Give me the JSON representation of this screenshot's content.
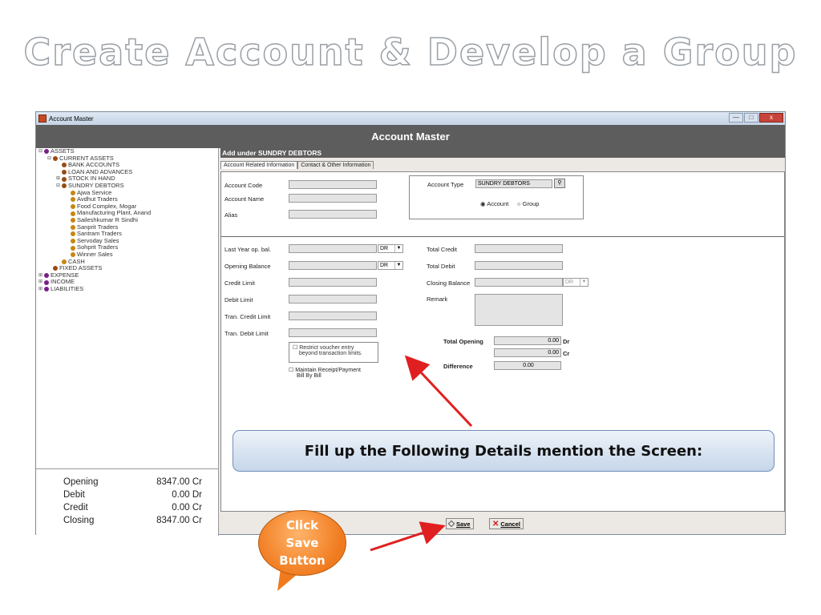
{
  "slide_title": "Create  Account & Develop a Group",
  "window": {
    "title": "Account Master",
    "header": "Account Master",
    "controls": {
      "minimize": "—",
      "maximize": "□",
      "close": "x"
    }
  },
  "tree": [
    {
      "label": "ASSETS",
      "level": 0,
      "expander": "⊟",
      "icon": "purple"
    },
    {
      "label": "CURRENT ASSETS",
      "level": 1,
      "expander": "⊟",
      "icon": "brown"
    },
    {
      "label": "BANK ACCOUNTS",
      "level": 2,
      "expander": "",
      "icon": "brown"
    },
    {
      "label": "LOAN AND ADVANCES",
      "level": 2,
      "expander": "",
      "icon": "brown"
    },
    {
      "label": "STOCK IN HAND",
      "level": 2,
      "expander": "⊞",
      "icon": "brown"
    },
    {
      "label": "SUNDRY DEBTORS",
      "level": 2,
      "expander": "⊟",
      "icon": "brown"
    },
    {
      "label": "Ajwa Service",
      "level": 3,
      "expander": "",
      "icon": "gold"
    },
    {
      "label": "Avdhut Traders",
      "level": 3,
      "expander": "",
      "icon": "gold"
    },
    {
      "label": "Food Complex, Mogar",
      "level": 3,
      "expander": "",
      "icon": "gold"
    },
    {
      "label": "Manufacturing Plant, Anand",
      "level": 3,
      "expander": "",
      "icon": "gold"
    },
    {
      "label": "Saileshkumar R Sindhi",
      "level": 3,
      "expander": "",
      "icon": "gold"
    },
    {
      "label": "Sanprit Traders",
      "level": 3,
      "expander": "",
      "icon": "gold"
    },
    {
      "label": "Santram Traders",
      "level": 3,
      "expander": "",
      "icon": "gold"
    },
    {
      "label": "Servoday Sales",
      "level": 3,
      "expander": "",
      "icon": "gold"
    },
    {
      "label": "Sohprit Traders",
      "level": 3,
      "expander": "",
      "icon": "gold"
    },
    {
      "label": "Winner Sales",
      "level": 3,
      "expander": "",
      "icon": "gold"
    },
    {
      "label": "CASH",
      "level": 2,
      "expander": "",
      "icon": "gold"
    },
    {
      "label": "FIXED ASSETS",
      "level": 1,
      "expander": "",
      "icon": "brown"
    },
    {
      "label": "EXPENSE",
      "level": 0,
      "expander": "⊞",
      "icon": "purple"
    },
    {
      "label": "INCOME",
      "level": 0,
      "expander": "⊞",
      "icon": "purple"
    },
    {
      "label": "LIABILITIES",
      "level": 0,
      "expander": "⊞",
      "icon": "purple"
    }
  ],
  "summary": {
    "opening_label": "Opening",
    "opening_value": "8347.00 Cr",
    "debit_label": "Debit",
    "debit_value": "0.00 Dr",
    "credit_label": "Credit",
    "credit_value": "0.00 Cr",
    "closing_label": "Closing",
    "closing_value": "8347.00 Cr"
  },
  "add_under": "Add under SUNDRY DEBTORS",
  "tabs": [
    "Account Related Information",
    "Contact & Other Information"
  ],
  "form": {
    "account_code": "Account Code",
    "account_name": "Account Name",
    "alias": "Alias",
    "account_type_label": "Account Type",
    "account_type_value": "SUNDRY DEBTORS",
    "radio_account": "Account",
    "radio_group": "Group",
    "last_year_op_bal": "Last Year op. bal.",
    "opening_balance": "Opening Balance",
    "credit_limit": "Credit Limit",
    "debit_limit": "Debit Limit",
    "tran_credit_limit": "Tran. Credit Limit",
    "tran_debit_limit": "Tran. Debit Limit",
    "dr": "DR",
    "total_credit": "Total Credit",
    "total_debit": "Total Debit",
    "closing_balance": "Closing Balance",
    "remark": "Remark",
    "total_opening_label": "Total Opening",
    "total_opening_dr_value": "0.00",
    "dr_suffix": "Dr",
    "total_opening_cr_value": "0.00",
    "cr_suffix": "Cr",
    "difference_label": "Difference",
    "difference_value": "0.00",
    "restrict_line1": "Restrict voucher entry",
    "restrict_line2": "beyond transaction limits.",
    "maintain_line1": "Maintain Receipt/Payment",
    "maintain_line2": "Bill By Bill"
  },
  "callout_text": "Fill up the Following Details mention the Screen:",
  "bubble": {
    "line1": "Click",
    "line2": "Save",
    "line3": "Button"
  },
  "buttons": {
    "save": "Save",
    "cancel": "Cancel"
  },
  "colors": {
    "header": "#5d5d5d",
    "arrow": "#e02020",
    "bubble": "#f07a1e",
    "callout_border": "#6f8fb6"
  }
}
